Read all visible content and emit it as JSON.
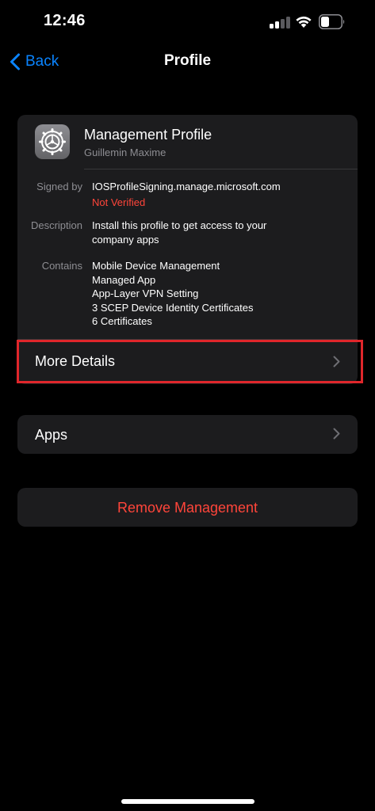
{
  "status_bar": {
    "time": "12:46",
    "icons": [
      "cellular-signal-icon",
      "wifi-icon",
      "battery-icon"
    ]
  },
  "nav": {
    "back_label": "Back",
    "title": "Profile"
  },
  "profile": {
    "icon": "settings-gear-icon",
    "name": "Management Profile",
    "organization": "Guillemin Maxime",
    "signed_by_label": "Signed by",
    "signed_by_value": "IOSProfileSigning.manage.microsoft.com",
    "verification_status": "Not Verified",
    "description_label": "Description",
    "description_lines": [
      "Install this profile to get access to your",
      "company apps"
    ],
    "contains_label": "Contains",
    "contains_items": [
      "Mobile Device Management",
      "Managed App",
      "App-Layer VPN Setting",
      "3 SCEP Device Identity Certificates",
      "6 Certificates"
    ],
    "more_details_label": "More Details"
  },
  "apps": {
    "label": "Apps"
  },
  "remove": {
    "label": "Remove Management"
  },
  "colors": {
    "background": "#000000",
    "cell_background": "#1c1c1e",
    "accent_blue": "#0a84ff",
    "destructive_red": "#ff453a",
    "highlight_red": "#e0262b",
    "secondary_text": "#8e8e93"
  }
}
